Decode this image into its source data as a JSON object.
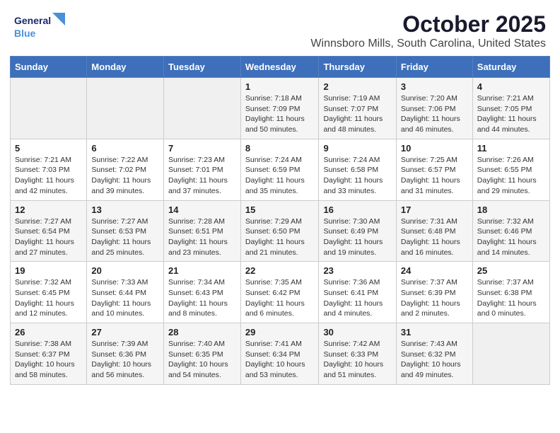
{
  "header": {
    "logo_general": "General",
    "logo_blue": "Blue",
    "month": "October 2025",
    "location": "Winnsboro Mills, South Carolina, United States"
  },
  "weekdays": [
    "Sunday",
    "Monday",
    "Tuesday",
    "Wednesday",
    "Thursday",
    "Friday",
    "Saturday"
  ],
  "weeks": [
    [
      {
        "day": "",
        "info": ""
      },
      {
        "day": "",
        "info": ""
      },
      {
        "day": "",
        "info": ""
      },
      {
        "day": "1",
        "info": "Sunrise: 7:18 AM\nSunset: 7:09 PM\nDaylight: 11 hours and 50 minutes."
      },
      {
        "day": "2",
        "info": "Sunrise: 7:19 AM\nSunset: 7:07 PM\nDaylight: 11 hours and 48 minutes."
      },
      {
        "day": "3",
        "info": "Sunrise: 7:20 AM\nSunset: 7:06 PM\nDaylight: 11 hours and 46 minutes."
      },
      {
        "day": "4",
        "info": "Sunrise: 7:21 AM\nSunset: 7:05 PM\nDaylight: 11 hours and 44 minutes."
      }
    ],
    [
      {
        "day": "5",
        "info": "Sunrise: 7:21 AM\nSunset: 7:03 PM\nDaylight: 11 hours and 42 minutes."
      },
      {
        "day": "6",
        "info": "Sunrise: 7:22 AM\nSunset: 7:02 PM\nDaylight: 11 hours and 39 minutes."
      },
      {
        "day": "7",
        "info": "Sunrise: 7:23 AM\nSunset: 7:01 PM\nDaylight: 11 hours and 37 minutes."
      },
      {
        "day": "8",
        "info": "Sunrise: 7:24 AM\nSunset: 6:59 PM\nDaylight: 11 hours and 35 minutes."
      },
      {
        "day": "9",
        "info": "Sunrise: 7:24 AM\nSunset: 6:58 PM\nDaylight: 11 hours and 33 minutes."
      },
      {
        "day": "10",
        "info": "Sunrise: 7:25 AM\nSunset: 6:57 PM\nDaylight: 11 hours and 31 minutes."
      },
      {
        "day": "11",
        "info": "Sunrise: 7:26 AM\nSunset: 6:55 PM\nDaylight: 11 hours and 29 minutes."
      }
    ],
    [
      {
        "day": "12",
        "info": "Sunrise: 7:27 AM\nSunset: 6:54 PM\nDaylight: 11 hours and 27 minutes."
      },
      {
        "day": "13",
        "info": "Sunrise: 7:27 AM\nSunset: 6:53 PM\nDaylight: 11 hours and 25 minutes."
      },
      {
        "day": "14",
        "info": "Sunrise: 7:28 AM\nSunset: 6:51 PM\nDaylight: 11 hours and 23 minutes."
      },
      {
        "day": "15",
        "info": "Sunrise: 7:29 AM\nSunset: 6:50 PM\nDaylight: 11 hours and 21 minutes."
      },
      {
        "day": "16",
        "info": "Sunrise: 7:30 AM\nSunset: 6:49 PM\nDaylight: 11 hours and 19 minutes."
      },
      {
        "day": "17",
        "info": "Sunrise: 7:31 AM\nSunset: 6:48 PM\nDaylight: 11 hours and 16 minutes."
      },
      {
        "day": "18",
        "info": "Sunrise: 7:32 AM\nSunset: 6:46 PM\nDaylight: 11 hours and 14 minutes."
      }
    ],
    [
      {
        "day": "19",
        "info": "Sunrise: 7:32 AM\nSunset: 6:45 PM\nDaylight: 11 hours and 12 minutes."
      },
      {
        "day": "20",
        "info": "Sunrise: 7:33 AM\nSunset: 6:44 PM\nDaylight: 11 hours and 10 minutes."
      },
      {
        "day": "21",
        "info": "Sunrise: 7:34 AM\nSunset: 6:43 PM\nDaylight: 11 hours and 8 minutes."
      },
      {
        "day": "22",
        "info": "Sunrise: 7:35 AM\nSunset: 6:42 PM\nDaylight: 11 hours and 6 minutes."
      },
      {
        "day": "23",
        "info": "Sunrise: 7:36 AM\nSunset: 6:41 PM\nDaylight: 11 hours and 4 minutes."
      },
      {
        "day": "24",
        "info": "Sunrise: 7:37 AM\nSunset: 6:39 PM\nDaylight: 11 hours and 2 minutes."
      },
      {
        "day": "25",
        "info": "Sunrise: 7:37 AM\nSunset: 6:38 PM\nDaylight: 11 hours and 0 minutes."
      }
    ],
    [
      {
        "day": "26",
        "info": "Sunrise: 7:38 AM\nSunset: 6:37 PM\nDaylight: 10 hours and 58 minutes."
      },
      {
        "day": "27",
        "info": "Sunrise: 7:39 AM\nSunset: 6:36 PM\nDaylight: 10 hours and 56 minutes."
      },
      {
        "day": "28",
        "info": "Sunrise: 7:40 AM\nSunset: 6:35 PM\nDaylight: 10 hours and 54 minutes."
      },
      {
        "day": "29",
        "info": "Sunrise: 7:41 AM\nSunset: 6:34 PM\nDaylight: 10 hours and 53 minutes."
      },
      {
        "day": "30",
        "info": "Sunrise: 7:42 AM\nSunset: 6:33 PM\nDaylight: 10 hours and 51 minutes."
      },
      {
        "day": "31",
        "info": "Sunrise: 7:43 AM\nSunset: 6:32 PM\nDaylight: 10 hours and 49 minutes."
      },
      {
        "day": "",
        "info": ""
      }
    ]
  ]
}
